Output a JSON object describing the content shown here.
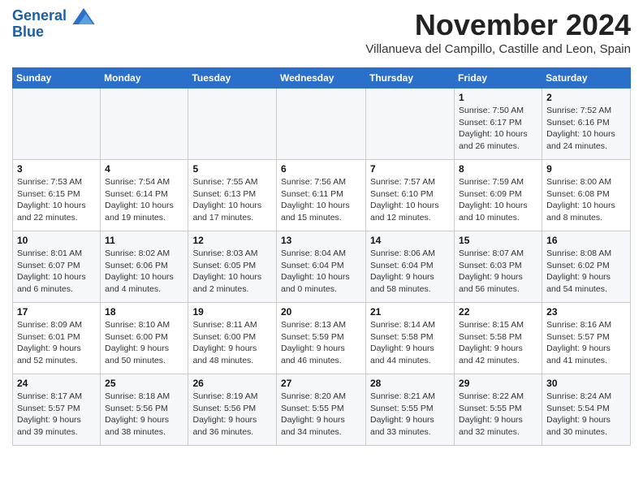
{
  "logo": {
    "line1": "General",
    "line2": "Blue"
  },
  "title": "November 2024",
  "subtitle": "Villanueva del Campillo, Castille and Leon, Spain",
  "days_header": [
    "Sunday",
    "Monday",
    "Tuesday",
    "Wednesday",
    "Thursday",
    "Friday",
    "Saturday"
  ],
  "weeks": [
    [
      {
        "num": "",
        "info": ""
      },
      {
        "num": "",
        "info": ""
      },
      {
        "num": "",
        "info": ""
      },
      {
        "num": "",
        "info": ""
      },
      {
        "num": "",
        "info": ""
      },
      {
        "num": "1",
        "info": "Sunrise: 7:50 AM\nSunset: 6:17 PM\nDaylight: 10 hours\nand 26 minutes."
      },
      {
        "num": "2",
        "info": "Sunrise: 7:52 AM\nSunset: 6:16 PM\nDaylight: 10 hours\nand 24 minutes."
      }
    ],
    [
      {
        "num": "3",
        "info": "Sunrise: 7:53 AM\nSunset: 6:15 PM\nDaylight: 10 hours\nand 22 minutes."
      },
      {
        "num": "4",
        "info": "Sunrise: 7:54 AM\nSunset: 6:14 PM\nDaylight: 10 hours\nand 19 minutes."
      },
      {
        "num": "5",
        "info": "Sunrise: 7:55 AM\nSunset: 6:13 PM\nDaylight: 10 hours\nand 17 minutes."
      },
      {
        "num": "6",
        "info": "Sunrise: 7:56 AM\nSunset: 6:11 PM\nDaylight: 10 hours\nand 15 minutes."
      },
      {
        "num": "7",
        "info": "Sunrise: 7:57 AM\nSunset: 6:10 PM\nDaylight: 10 hours\nand 12 minutes."
      },
      {
        "num": "8",
        "info": "Sunrise: 7:59 AM\nSunset: 6:09 PM\nDaylight: 10 hours\nand 10 minutes."
      },
      {
        "num": "9",
        "info": "Sunrise: 8:00 AM\nSunset: 6:08 PM\nDaylight: 10 hours\nand 8 minutes."
      }
    ],
    [
      {
        "num": "10",
        "info": "Sunrise: 8:01 AM\nSunset: 6:07 PM\nDaylight: 10 hours\nand 6 minutes."
      },
      {
        "num": "11",
        "info": "Sunrise: 8:02 AM\nSunset: 6:06 PM\nDaylight: 10 hours\nand 4 minutes."
      },
      {
        "num": "12",
        "info": "Sunrise: 8:03 AM\nSunset: 6:05 PM\nDaylight: 10 hours\nand 2 minutes."
      },
      {
        "num": "13",
        "info": "Sunrise: 8:04 AM\nSunset: 6:04 PM\nDaylight: 10 hours\nand 0 minutes."
      },
      {
        "num": "14",
        "info": "Sunrise: 8:06 AM\nSunset: 6:04 PM\nDaylight: 9 hours\nand 58 minutes."
      },
      {
        "num": "15",
        "info": "Sunrise: 8:07 AM\nSunset: 6:03 PM\nDaylight: 9 hours\nand 56 minutes."
      },
      {
        "num": "16",
        "info": "Sunrise: 8:08 AM\nSunset: 6:02 PM\nDaylight: 9 hours\nand 54 minutes."
      }
    ],
    [
      {
        "num": "17",
        "info": "Sunrise: 8:09 AM\nSunset: 6:01 PM\nDaylight: 9 hours\nand 52 minutes."
      },
      {
        "num": "18",
        "info": "Sunrise: 8:10 AM\nSunset: 6:00 PM\nDaylight: 9 hours\nand 50 minutes."
      },
      {
        "num": "19",
        "info": "Sunrise: 8:11 AM\nSunset: 6:00 PM\nDaylight: 9 hours\nand 48 minutes."
      },
      {
        "num": "20",
        "info": "Sunrise: 8:13 AM\nSunset: 5:59 PM\nDaylight: 9 hours\nand 46 minutes."
      },
      {
        "num": "21",
        "info": "Sunrise: 8:14 AM\nSunset: 5:58 PM\nDaylight: 9 hours\nand 44 minutes."
      },
      {
        "num": "22",
        "info": "Sunrise: 8:15 AM\nSunset: 5:58 PM\nDaylight: 9 hours\nand 42 minutes."
      },
      {
        "num": "23",
        "info": "Sunrise: 8:16 AM\nSunset: 5:57 PM\nDaylight: 9 hours\nand 41 minutes."
      }
    ],
    [
      {
        "num": "24",
        "info": "Sunrise: 8:17 AM\nSunset: 5:57 PM\nDaylight: 9 hours\nand 39 minutes."
      },
      {
        "num": "25",
        "info": "Sunrise: 8:18 AM\nSunset: 5:56 PM\nDaylight: 9 hours\nand 38 minutes."
      },
      {
        "num": "26",
        "info": "Sunrise: 8:19 AM\nSunset: 5:56 PM\nDaylight: 9 hours\nand 36 minutes."
      },
      {
        "num": "27",
        "info": "Sunrise: 8:20 AM\nSunset: 5:55 PM\nDaylight: 9 hours\nand 34 minutes."
      },
      {
        "num": "28",
        "info": "Sunrise: 8:21 AM\nSunset: 5:55 PM\nDaylight: 9 hours\nand 33 minutes."
      },
      {
        "num": "29",
        "info": "Sunrise: 8:22 AM\nSunset: 5:55 PM\nDaylight: 9 hours\nand 32 minutes."
      },
      {
        "num": "30",
        "info": "Sunrise: 8:24 AM\nSunset: 5:54 PM\nDaylight: 9 hours\nand 30 minutes."
      }
    ]
  ]
}
